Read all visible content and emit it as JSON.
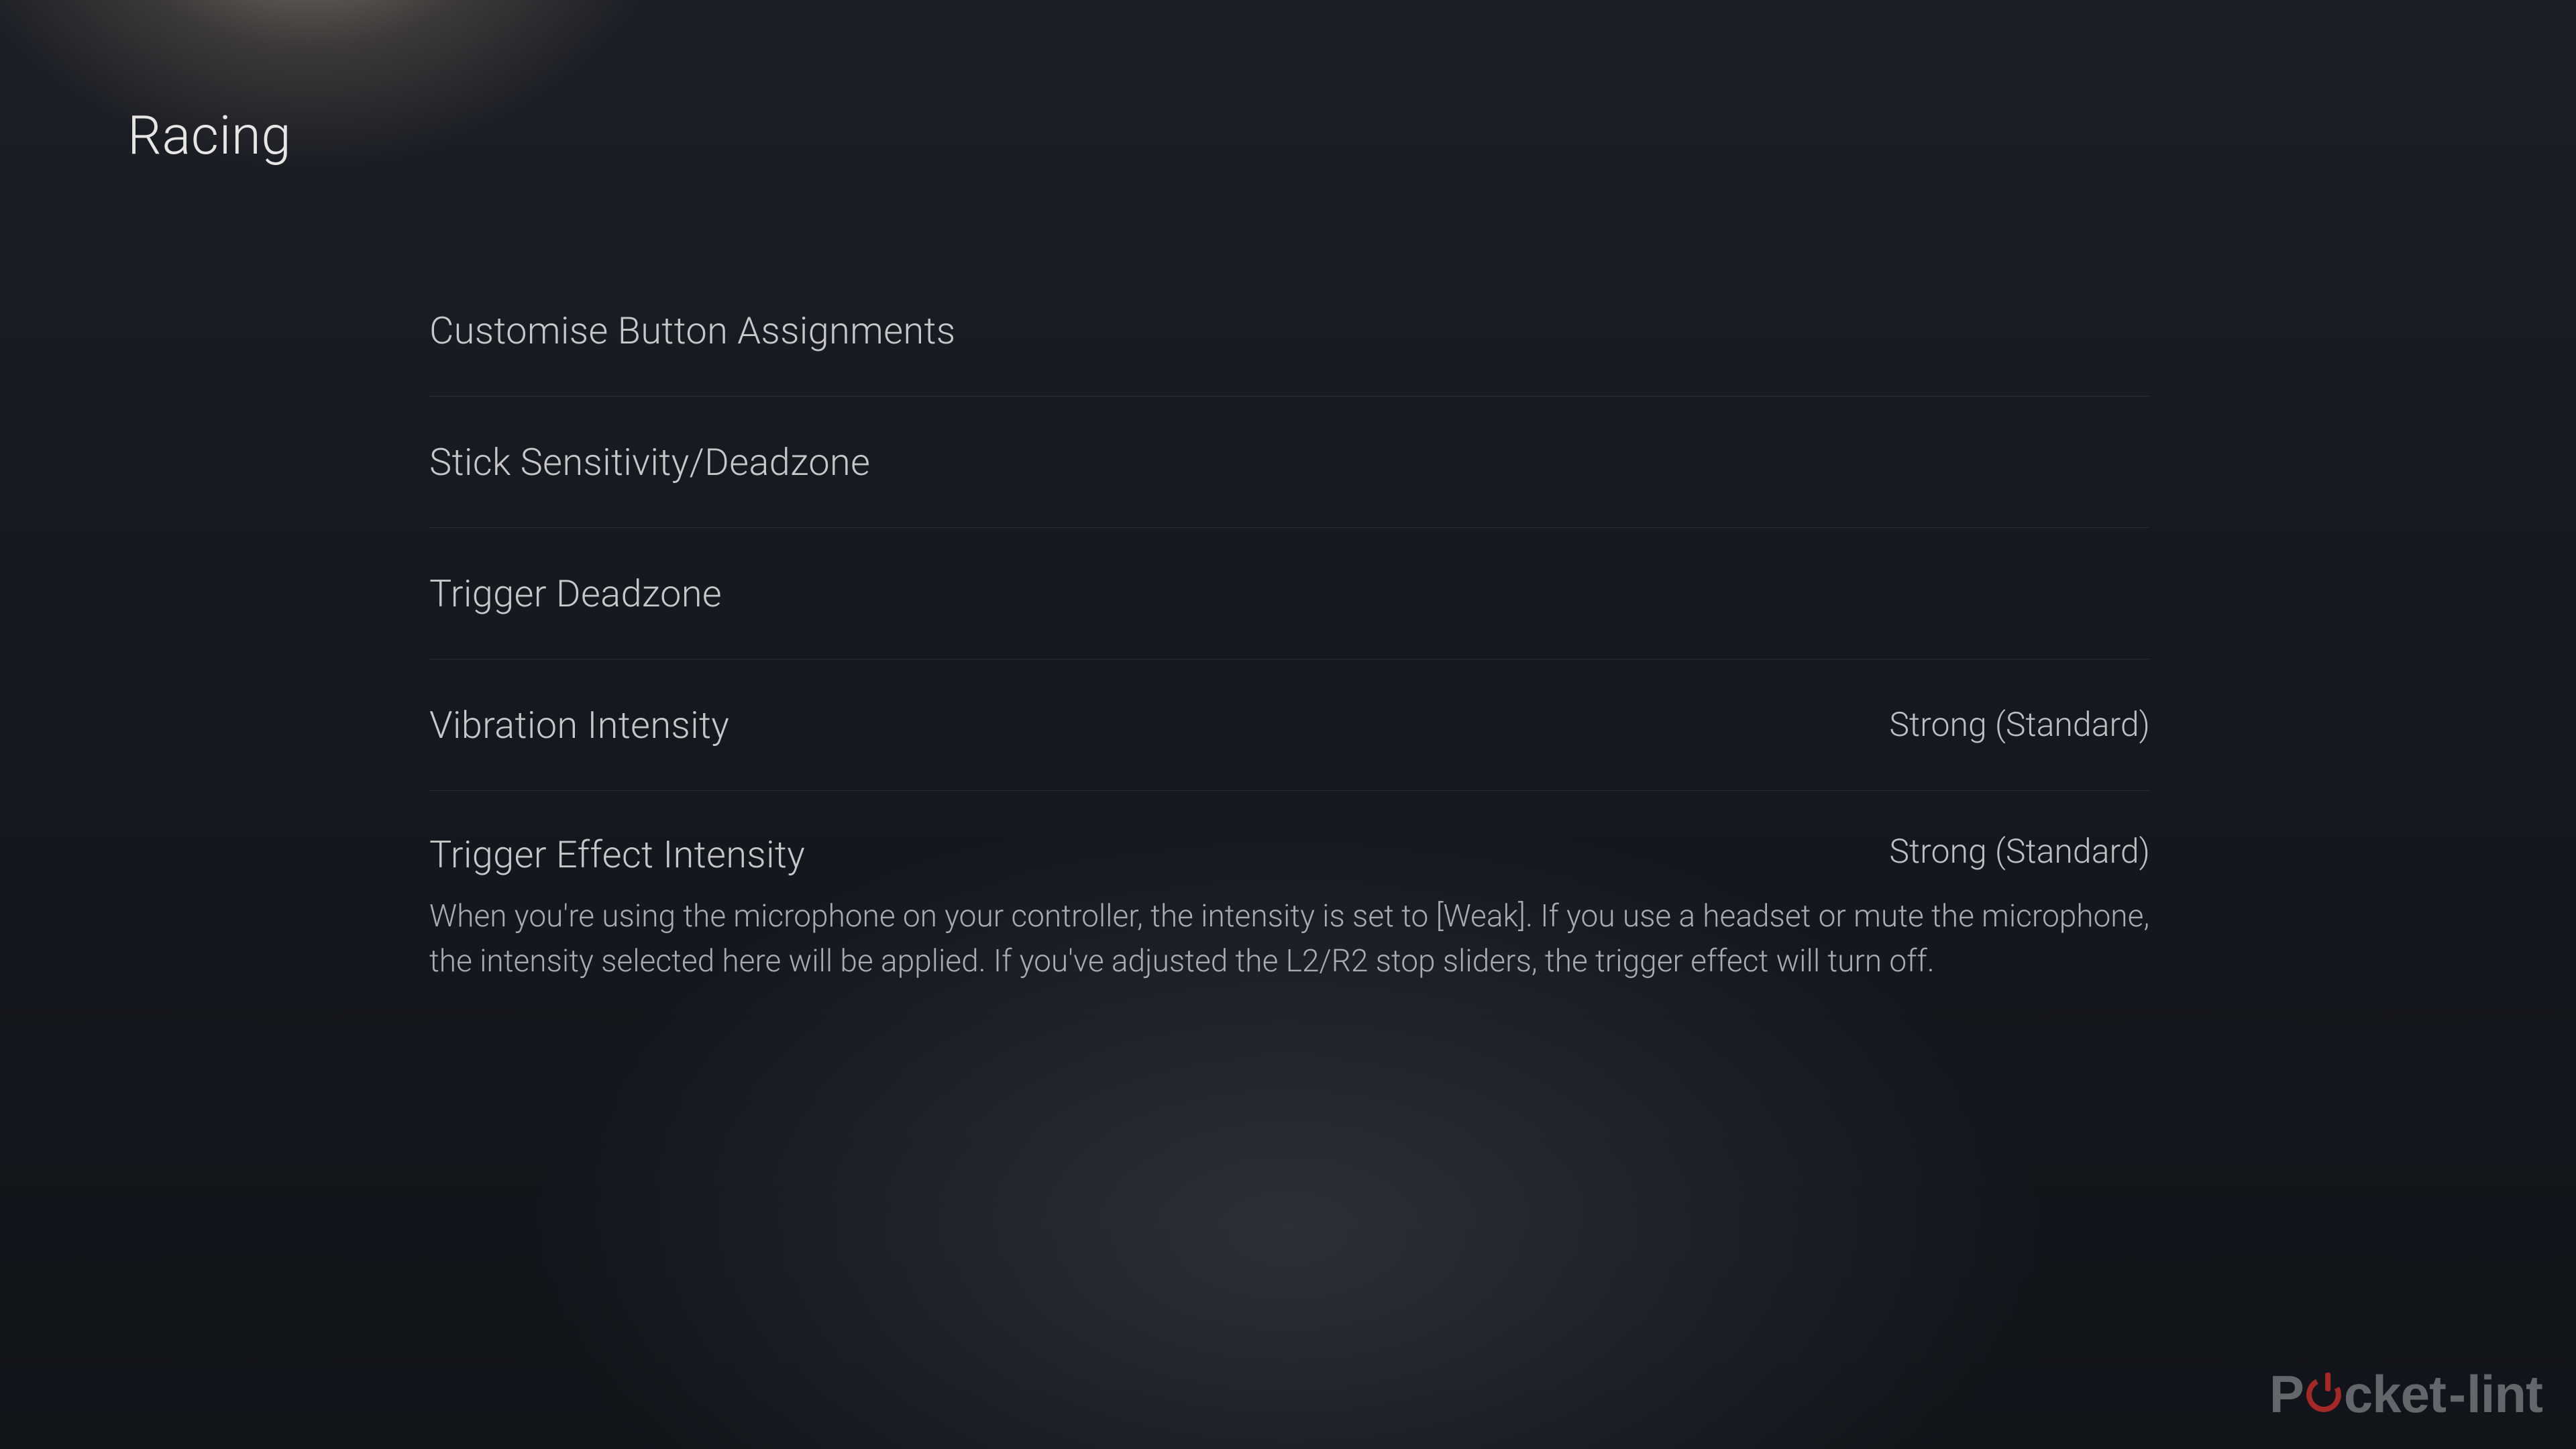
{
  "page": {
    "title": "Racing"
  },
  "settings": {
    "items": [
      {
        "label": "Customise Button Assignments",
        "value": ""
      },
      {
        "label": "Stick Sensitivity/Deadzone",
        "value": ""
      },
      {
        "label": "Trigger Deadzone",
        "value": ""
      },
      {
        "label": "Vibration Intensity",
        "value": "Strong (Standard)"
      },
      {
        "label": "Trigger Effect Intensity",
        "value": "Strong (Standard)",
        "description": "When you're using the microphone on your controller, the intensity is set to [Weak]. If you use a headset or mute the microphone, the intensity selected here will be applied. If you've adjusted the L2/R2 stop sliders, the trigger effect will turn off."
      }
    ]
  },
  "watermark": {
    "part1": "P",
    "part2": "cket",
    "part3": "lint",
    "hyphen": "-"
  }
}
